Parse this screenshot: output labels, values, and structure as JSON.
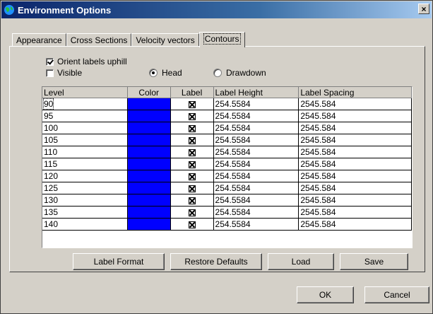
{
  "window": {
    "title": "Environment Options",
    "close_label": "×"
  },
  "tabs": [
    {
      "label": "Appearance",
      "active": false
    },
    {
      "label": "Cross Sections",
      "active": false
    },
    {
      "label": "Velocity vectors",
      "active": false
    },
    {
      "label": "Contours",
      "active": true
    }
  ],
  "options": {
    "orient_label": "Orient labels uphill",
    "orient_checked": true,
    "visible_label": "Visible",
    "visible_checked": false,
    "head_label": "Head",
    "drawdown_label": "Drawdown",
    "selected_mode": "Head"
  },
  "grid": {
    "columns": [
      "Level",
      "Color",
      "Label",
      "Label Height",
      "Label Spacing"
    ],
    "rows": [
      {
        "level": "90",
        "color": "#0000ff",
        "label": true,
        "height": "254.5584",
        "spacing": "2545.584"
      },
      {
        "level": "95",
        "color": "#0000ff",
        "label": true,
        "height": "254.5584",
        "spacing": "2545.584"
      },
      {
        "level": "100",
        "color": "#0000ff",
        "label": true,
        "height": "254.5584",
        "spacing": "2545.584"
      },
      {
        "level": "105",
        "color": "#0000ff",
        "label": true,
        "height": "254.5584",
        "spacing": "2545.584"
      },
      {
        "level": "110",
        "color": "#0000ff",
        "label": true,
        "height": "254.5584",
        "spacing": "2545.584"
      },
      {
        "level": "115",
        "color": "#0000ff",
        "label": true,
        "height": "254.5584",
        "spacing": "2545.584"
      },
      {
        "level": "120",
        "color": "#0000ff",
        "label": true,
        "height": "254.5584",
        "spacing": "2545.584"
      },
      {
        "level": "125",
        "color": "#0000ff",
        "label": true,
        "height": "254.5584",
        "spacing": "2545.584"
      },
      {
        "level": "130",
        "color": "#0000ff",
        "label": true,
        "height": "254.5584",
        "spacing": "2545.584"
      },
      {
        "level": "135",
        "color": "#0000ff",
        "label": true,
        "height": "254.5584",
        "spacing": "2545.584"
      },
      {
        "level": "140",
        "color": "#0000ff",
        "label": true,
        "height": "254.5584",
        "spacing": "2545.584"
      }
    ]
  },
  "buttons": {
    "label_format": "Label Format",
    "restore_defaults": "Restore Defaults",
    "load": "Load",
    "save": "Save",
    "ok": "OK",
    "cancel": "Cancel"
  }
}
